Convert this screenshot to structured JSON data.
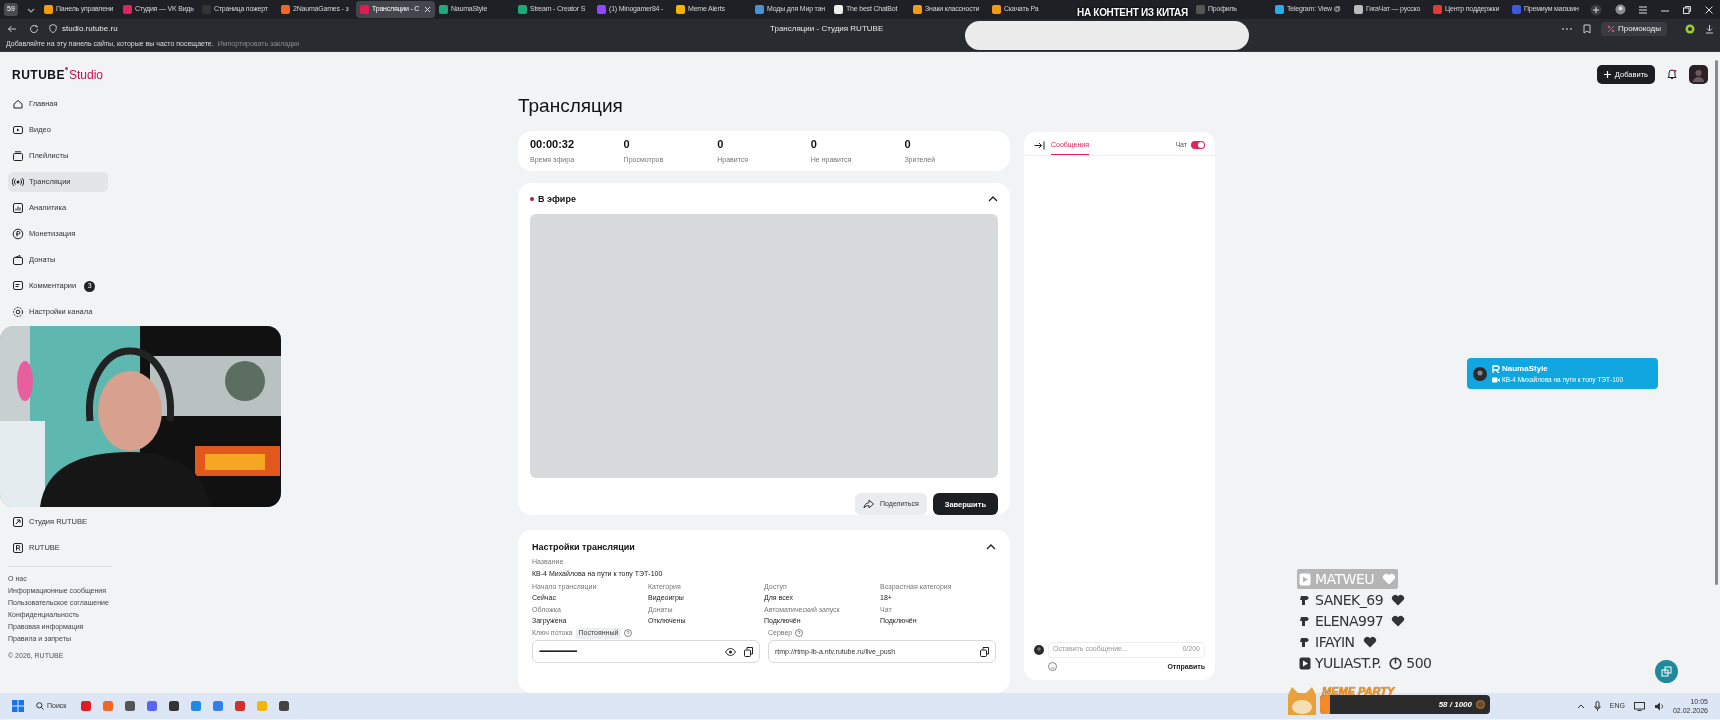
{
  "browser": {
    "tab_count": "59",
    "tabs": [
      {
        "title": "Панель управлени",
        "color": "#f39c12",
        "selected": false
      },
      {
        "title": "Студия — VK Видь",
        "color": "#e0245e",
        "selected": false
      },
      {
        "title": "Страница пожерт",
        "color": "#333333",
        "selected": false
      },
      {
        "title": "2NaumaGames - з",
        "color": "#f26522",
        "selected": false
      },
      {
        "title": "Трансляции - С",
        "color": "#e31b54",
        "selected": true
      },
      {
        "title": "NaumaStyle",
        "color": "#1fa97a",
        "selected": false
      },
      {
        "title": "Stream - Creator S",
        "color": "#1fa97a",
        "selected": false
      },
      {
        "title": "(1) Minogamer84 -",
        "color": "#9146ff",
        "selected": false
      },
      {
        "title": "Meme Alerts",
        "color": "#f5b400",
        "selected": false
      },
      {
        "title": "Моды для Мир тан",
        "color": "#4a90d9",
        "selected": false
      },
      {
        "title": "The best ChatBot",
        "color": "#eeeeee",
        "selected": false
      },
      {
        "title": "Знаки классности",
        "color": "#f39c12",
        "selected": false
      },
      {
        "title": "Скачать Ра",
        "color": "#f39c12",
        "selected": false
      },
      {
        "title": "Профиль",
        "color": "#555555",
        "selected": false
      },
      {
        "title": "Telegram: View @",
        "color": "#2aabee",
        "selected": false
      },
      {
        "title": "ГигаЧат — русско",
        "color": "#bbbbbb",
        "selected": false
      },
      {
        "title": "Центр поддержки",
        "color": "#e53935",
        "selected": false
      },
      {
        "title": "Премиум магазин",
        "color": "#3b5bdb",
        "selected": false
      }
    ],
    "url": "studio.rutube.ru",
    "page_title": "Трансляции - Студия RUTUBE",
    "promo": "Промокоды",
    "bookmarks_hint": "Добавляйте на эту панель сайты, которые вы часто посещаете.",
    "bookmarks_import": "Импортировать закладки"
  },
  "overlay_banner": "НА КОНТЕНТ ИЗ КИТАЯ",
  "logo": {
    "brand": "RUTUBE",
    "product": "Studio"
  },
  "sidebar": {
    "items": [
      {
        "label": "Главная",
        "selected": false
      },
      {
        "label": "Видео",
        "selected": false
      },
      {
        "label": "Плейлисты",
        "selected": false
      },
      {
        "label": "Трансляции",
        "selected": true
      },
      {
        "label": "Аналитика",
        "selected": false
      },
      {
        "label": "Монетизация",
        "selected": false
      },
      {
        "label": "Донаты",
        "selected": false
      },
      {
        "label": "Комментарии",
        "selected": false,
        "badge": "3"
      },
      {
        "label": "Настройки канала",
        "selected": false
      }
    ],
    "links": [
      "Студия RUTUBE",
      "RUTUBE"
    ],
    "footer": [
      "О нас",
      "Информационные сообщения",
      "Пользовательское соглашение",
      "Конфиденциальность",
      "Правовая информация",
      "Правила и запреты"
    ],
    "copyright": "© 2026, RUTUBE"
  },
  "header": {
    "add_button": "Добавить"
  },
  "page_title": "Трансляция",
  "stats": [
    {
      "value": "00:00:32",
      "label": "Время эфира"
    },
    {
      "value": "0",
      "label": "Просмотров"
    },
    {
      "value": "0",
      "label": "Нравится"
    },
    {
      "value": "0",
      "label": "Не нравится"
    },
    {
      "value": "0",
      "label": "Зрителей"
    }
  ],
  "live": {
    "title": "В эфире",
    "expanded": true,
    "share": "Поделиться",
    "finish": "Завершить"
  },
  "settings": {
    "title": "Настройки трансляции",
    "expanded": true,
    "name_label": "Название",
    "name": "КВ-4 Михайлова на пути к топу ТЭТ-100",
    "fields": [
      {
        "label": "Начало трансляции",
        "value": "Сейчас"
      },
      {
        "label": "Категория",
        "value": "Видеоигры"
      },
      {
        "label": "Доступ",
        "value": "Для всех"
      },
      {
        "label": "Возрастная категория",
        "value": "18+"
      },
      {
        "label": "Обложка",
        "value": "Загружена"
      },
      {
        "label": "Донаты",
        "value": "Отключены"
      },
      {
        "label": "Автоматический запуск",
        "value": "Подключён"
      },
      {
        "label": "Чат",
        "value": "Подключён"
      }
    ],
    "key_label": "Ключ потока",
    "key_badge": "Постоянный",
    "key_value": "••••••••••••••••••••••••••••••••••••••••••••••••••••••••••••••••",
    "server_label": "Сервер",
    "server_value": "rtmp://rtmp-lb-a.ntv.rutube.ru/live_push"
  },
  "chat": {
    "tab": "Сообщения",
    "tab_selected": true,
    "toggle_label": "Чат",
    "on": true,
    "placeholder": "Оставить сообщение...",
    "counter": "0/200",
    "send": "Отправить"
  },
  "notification": {
    "name": "NaumaStyle",
    "text": "КВ-4 Михайлова на пути к топу ТЭТ-100"
  },
  "alerts": [
    {
      "kind": "video",
      "name": "MATWEU",
      "selected": true
    },
    {
      "kind": "fan",
      "name": "SANEK_69",
      "selected": false
    },
    {
      "kind": "fan",
      "name": "ELENA997",
      "selected": false
    },
    {
      "kind": "fan",
      "name": "IFAYIN",
      "selected": false
    },
    {
      "kind": "video",
      "name": "YULIAST.P.",
      "selected": false,
      "amount": "500"
    }
  ],
  "meme_party": {
    "title": "MEME PARTY",
    "progress": "58 / 1000",
    "level": 0.058
  },
  "taskbar": {
    "search": "Поиск",
    "lang": "ENG",
    "time": "10:05",
    "date": "02.02.2026"
  }
}
